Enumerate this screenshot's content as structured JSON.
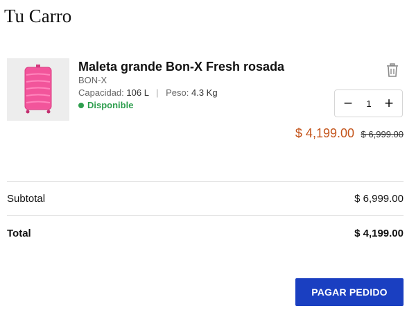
{
  "page": {
    "title": "Tu Carro"
  },
  "cart": {
    "item": {
      "name": "Maleta grande Bon-X Fresh rosada",
      "brand": "BON-X",
      "capacity_label": "Capacidad:",
      "capacity_value": "106 L",
      "separator": "|",
      "weight_label": "Peso:",
      "weight_value": "4.3 Kg",
      "availability": "Disponible",
      "quantity": "1",
      "minus": "−",
      "plus": "+",
      "price": "$ 4,199.00",
      "old_price": "$ 6,999.00",
      "image_icon": "pink-suitcase",
      "delete_icon": "trash-icon"
    }
  },
  "summary": {
    "subtotal_label": "Subtotal",
    "subtotal_value": "$ 6,999.00",
    "total_label": "Total",
    "total_value": "$ 4,199.00"
  },
  "checkout": {
    "button_label": "PAGAR PEDIDO"
  },
  "colors": {
    "accent_button": "#1a3fc1",
    "sale_price": "#c4551c",
    "in_stock": "#2e9e4e",
    "product_pink": "#f2559b"
  }
}
